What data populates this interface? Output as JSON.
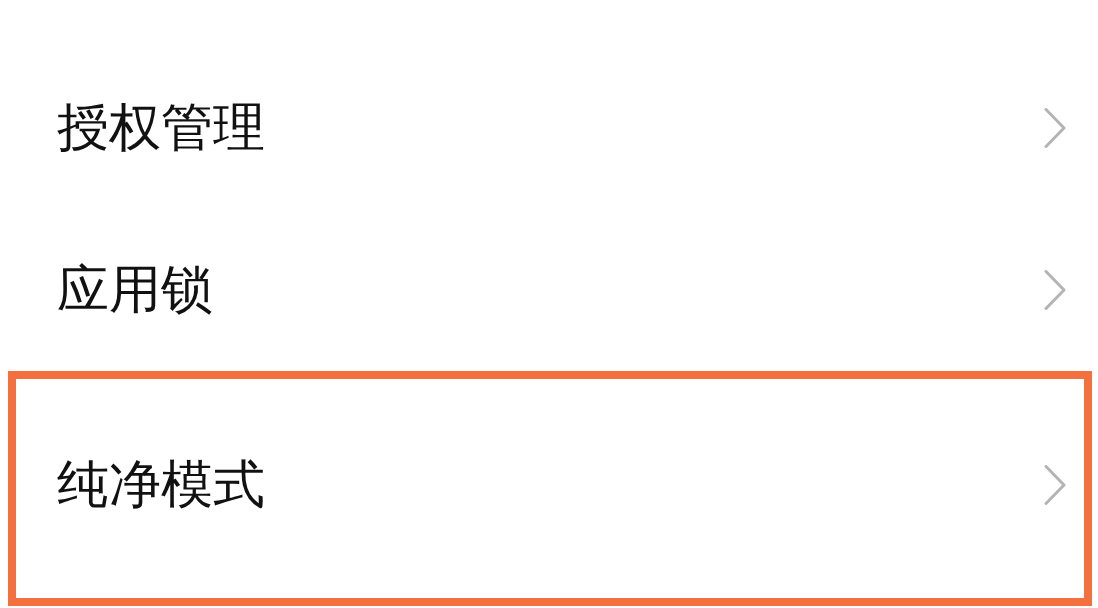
{
  "items": [
    {
      "label": "授权管理",
      "highlighted": false
    },
    {
      "label": "应用锁",
      "highlighted": false
    },
    {
      "label": "纯净模式",
      "highlighted": true
    }
  ]
}
